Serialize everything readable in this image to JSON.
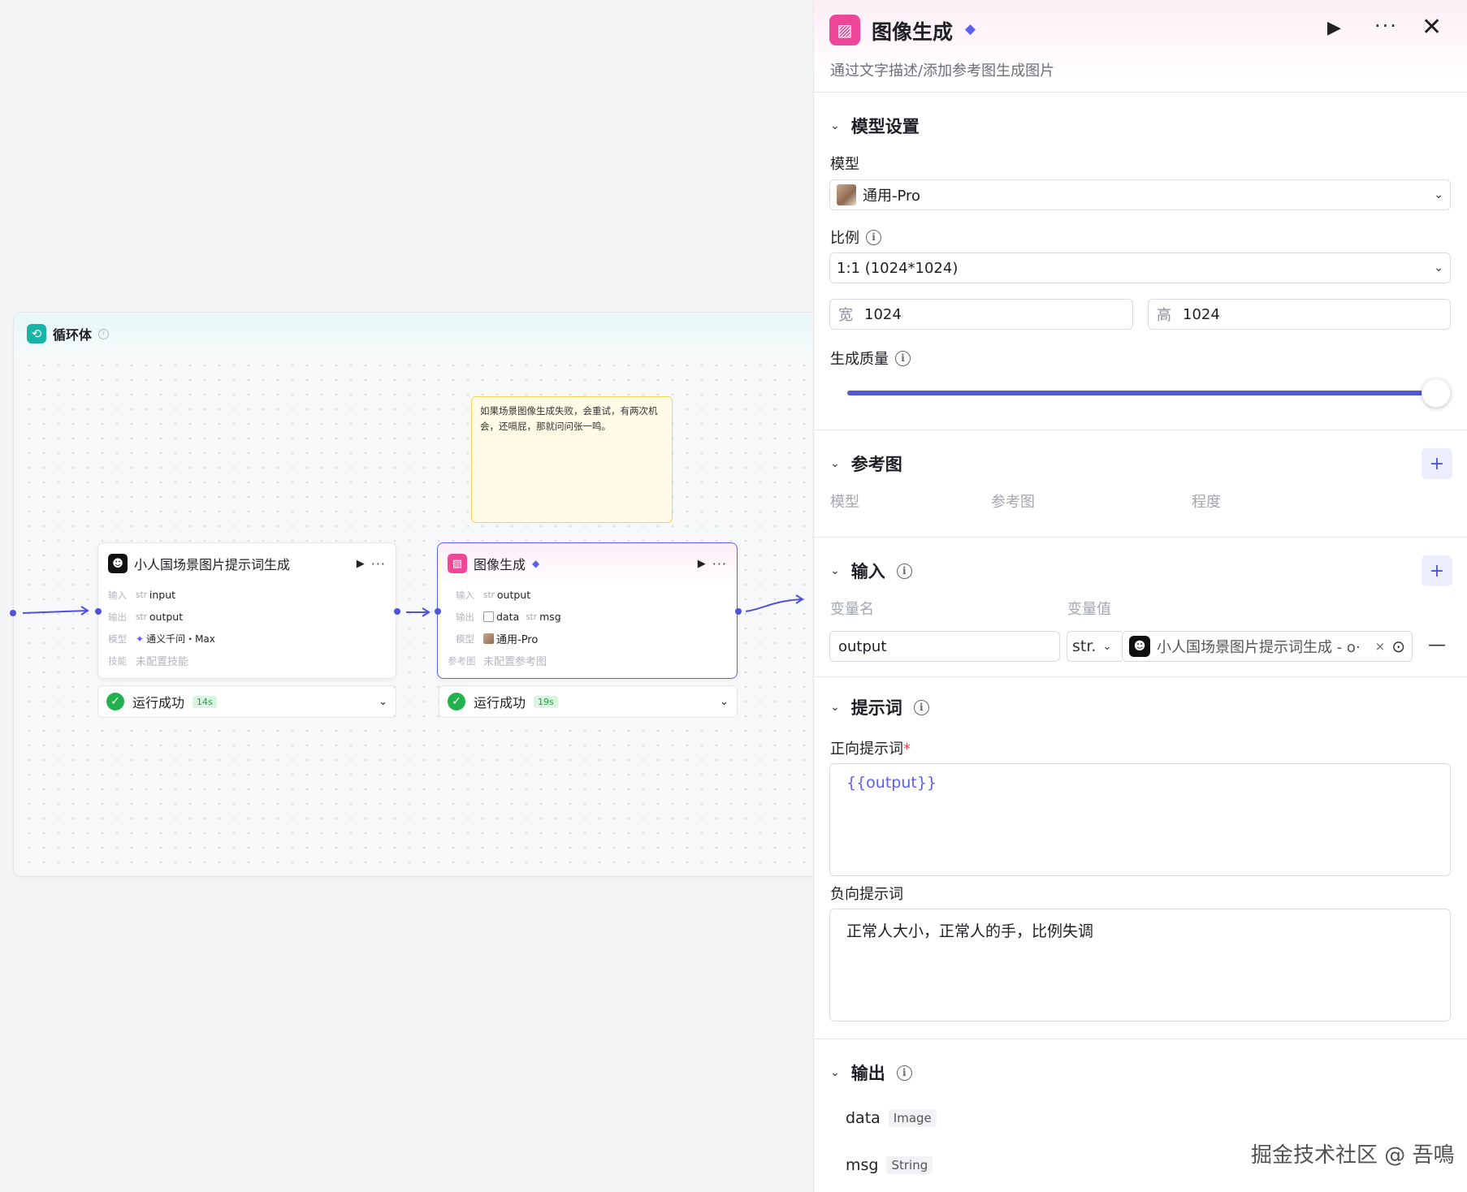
{
  "canvas": {
    "loop": {
      "title": "循环体"
    },
    "note": {
      "text": "如果场景图像生成失败，会重试，有两次机会，还嗝屁，那就问问张一鸣。"
    },
    "node1": {
      "title": "小人国场景图片提示词生成",
      "input_label": "输入",
      "input_type": "str",
      "input_value": "input",
      "output_label": "输出",
      "output_type": "str",
      "output_value": "output",
      "model_label": "模型",
      "model_value": "通义千问・Max",
      "skill_label": "技能",
      "skill_value": "未配置技能",
      "status": "运行成功",
      "time": "14s"
    },
    "node2": {
      "title": "图像生成",
      "input_label": "输入",
      "input_type": "str",
      "input_value": "output",
      "output_label": "输出",
      "output_value_1": "data",
      "output_type_2": "str",
      "output_value_2": "msg",
      "model_label": "模型",
      "model_value": "通用-Pro",
      "ref_label": "参考图",
      "ref_value": "未配置参考图",
      "status": "运行成功",
      "time": "19s"
    }
  },
  "panel": {
    "title": "图像生成",
    "subtitle": "通过文字描述/添加参考图生成图片",
    "model_section": {
      "heading": "模型设置",
      "model_label": "模型",
      "model_value": "通用-Pro",
      "ratio_label": "比例",
      "ratio_value": "1:1 (1024*1024)",
      "width_prefix": "宽",
      "width_value": "1024",
      "height_prefix": "高",
      "height_value": "1024",
      "quality_label": "生成质量",
      "quality_level": 1.0
    },
    "ref_section": {
      "heading": "参考图",
      "col_model": "模型",
      "col_ref": "参考图",
      "col_degree": "程度"
    },
    "input_section": {
      "heading": "输入",
      "col_name": "变量名",
      "col_value": "变量值",
      "var_name": "output",
      "var_type": "str.",
      "ref_text": "小人国场景图片提示词生成 - o·"
    },
    "prompt_section": {
      "heading": "提示词",
      "positive_label": "正向提示词",
      "required_mark": "*",
      "positive_value": "{{output}}",
      "negative_label": "负向提示词",
      "negative_value": "正常人大小，正常人的手，比例失调"
    },
    "output_section": {
      "heading": "输出",
      "items": [
        {
          "name": "data",
          "type": "Image"
        },
        {
          "name": "msg",
          "type": "String"
        }
      ]
    }
  },
  "watermark": "掘金技术社区 @ 吾鳴",
  "colors": {
    "accent": "#5b5ff0",
    "brand_pink": "#f0469a",
    "success": "#23b14d",
    "loop_teal": "#16b3a8"
  }
}
